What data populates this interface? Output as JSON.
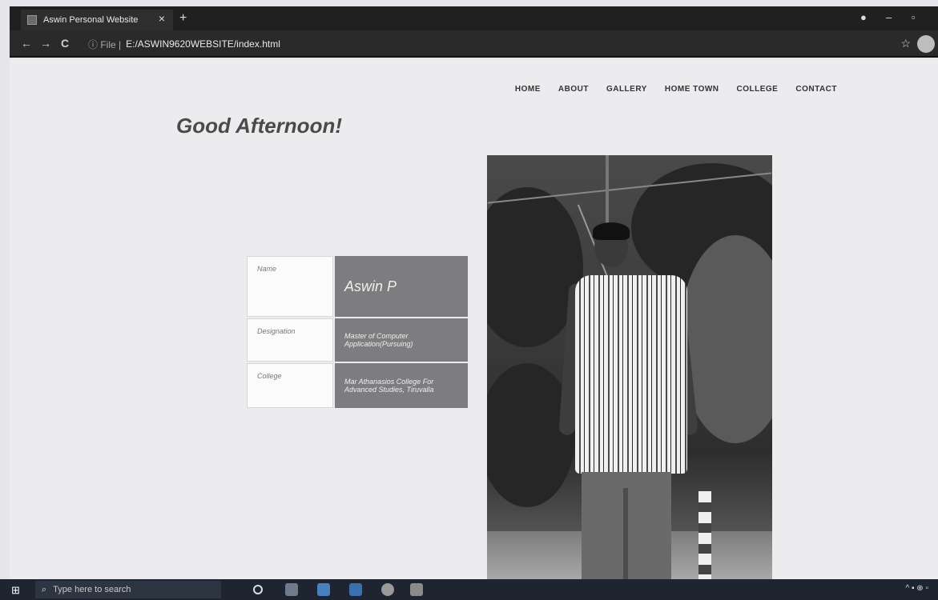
{
  "browser": {
    "tab_title": "Aswin Personal Website",
    "tab_close": "×",
    "new_tab": "+",
    "url_info": "ⓘ File |",
    "url": "E:/ASWIN9620WEBSITE/index.html",
    "back_icon": "←",
    "forward_icon": "→",
    "reload_icon": "C"
  },
  "nav": {
    "items": [
      "HOME",
      "ABOUT",
      "GALLERY",
      "HOME TOWN",
      "COLLEGE",
      "CONTACT"
    ]
  },
  "greeting": "Good Afternoon!",
  "profile": {
    "rows": [
      {
        "label": "Name",
        "value": "Aswin P"
      },
      {
        "label": "Designation",
        "value": "Master of Computer Application(Pursuing)"
      },
      {
        "label": "College",
        "value": "Mar Athanasios College For Advanced Studies, Tiruvalla"
      }
    ]
  },
  "taskbar": {
    "search_placeholder": "Type here to search"
  },
  "colors": {
    "value_cell": "#7d7d80",
    "page_bg": "#ececef",
    "taskbar": "#1e2430"
  }
}
